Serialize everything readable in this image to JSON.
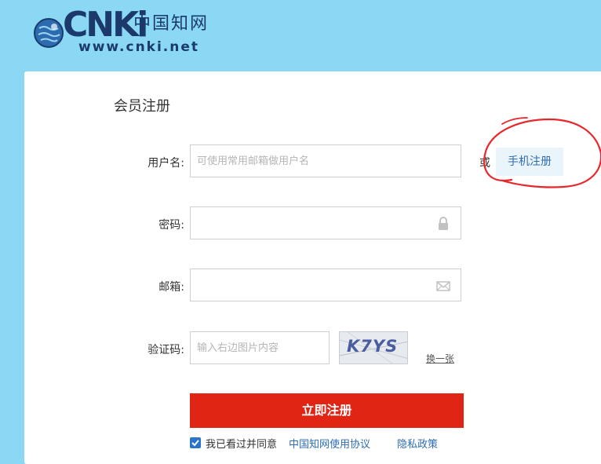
{
  "logo": {
    "brand_text": "CNKi",
    "chinese_name": "中国知网",
    "url_text": "www.cnki.net"
  },
  "form": {
    "title": "会员注册",
    "username": {
      "label": "用户名:",
      "placeholder": "可使用常用邮箱做用户名"
    },
    "or_text": "或",
    "phone_register": "手机注册",
    "password": {
      "label": "密码:",
      "icon": "lock-icon"
    },
    "email": {
      "label": "邮箱:",
      "icon": "envelope-icon"
    },
    "captcha": {
      "label": "验证码:",
      "placeholder": "输入右边图片内容",
      "image_text": "K7YS",
      "refresh": "换一张"
    },
    "submit": "立即注册",
    "agreement": {
      "checked": true,
      "text": "我已看过并同意",
      "link1": "中国知网使用协议",
      "link2": "隐私政策"
    }
  },
  "colors": {
    "background": "#8ad8f4",
    "primary_button": "#e02514",
    "link": "#2e6db4",
    "annotation": "#e8262b"
  }
}
